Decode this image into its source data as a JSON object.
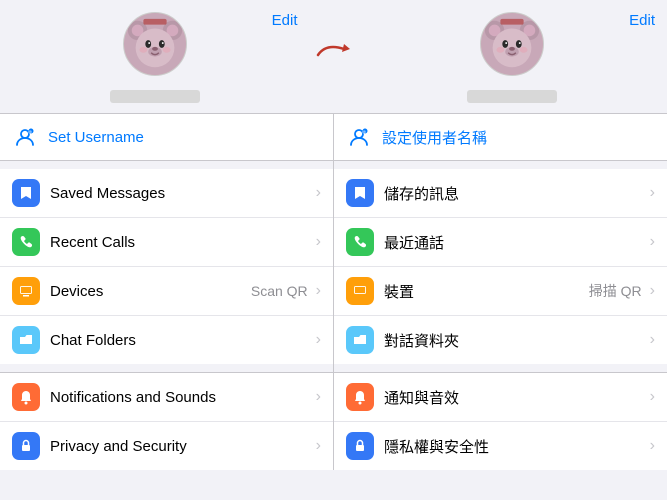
{
  "left": {
    "edit": "Edit",
    "username_icon": "👤",
    "username_label": "Set Username",
    "items": [
      {
        "label": "Saved Messages",
        "hint": "",
        "icon_color": "#3478f6",
        "icon": "🔖"
      },
      {
        "label": "Recent Calls",
        "hint": "",
        "icon_color": "#34c759",
        "icon": "📞"
      },
      {
        "label": "Devices",
        "hint": "Scan QR",
        "icon_color": "#ff9f0a",
        "icon": "🖥"
      },
      {
        "label": "Chat Folders",
        "hint": "",
        "icon_color": "#5ac8fa",
        "icon": "📁"
      }
    ],
    "bottom_items": [
      {
        "label": "Notifications and Sounds",
        "hint": "",
        "icon_color": "#ff6b35",
        "icon": "🔔"
      },
      {
        "label": "Privacy and Security",
        "hint": "",
        "icon_color": "#3478f6",
        "icon": "🔒"
      }
    ]
  },
  "right": {
    "edit": "Edit",
    "username_icon": "👤",
    "username_label": "設定使用者名稱",
    "items": [
      {
        "label": "儲存的訊息",
        "hint": "",
        "icon_color": "#3478f6",
        "icon": "🔖"
      },
      {
        "label": "最近通話",
        "hint": "",
        "icon_color": "#34c759",
        "icon": "📞"
      },
      {
        "label": "裝置",
        "hint": "掃描 QR",
        "icon_color": "#ff9f0a",
        "icon": "🖥"
      },
      {
        "label": "對話資料夾",
        "hint": "",
        "icon_color": "#5ac8fa",
        "icon": "📁"
      }
    ],
    "bottom_items": [
      {
        "label": "通知與音效",
        "hint": "",
        "icon_color": "#ff6b35",
        "icon": "🔔"
      },
      {
        "label": "隱私權與安全性",
        "hint": "",
        "icon_color": "#3478f6",
        "icon": "🔒"
      }
    ]
  },
  "arrow": "→"
}
